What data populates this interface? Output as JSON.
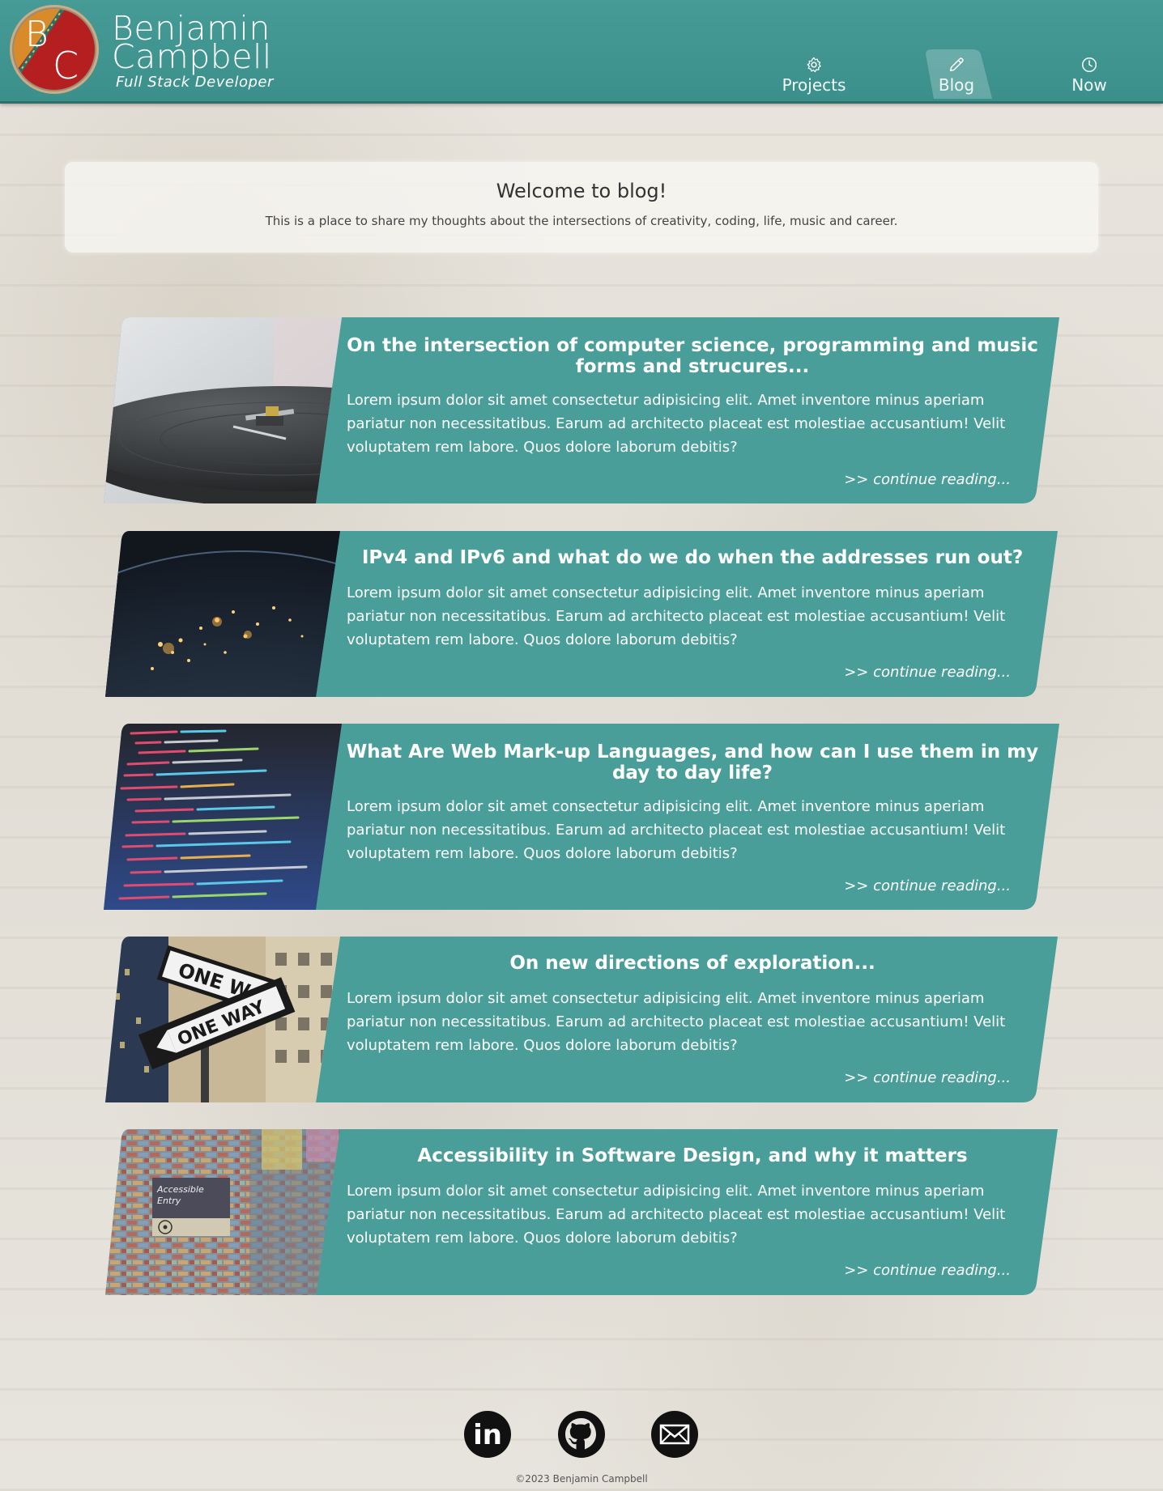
{
  "brand": {
    "monogram_left": "B",
    "monogram_right": "C",
    "name_line1": "Benjamin",
    "name_line2": "Campbell",
    "tagline": "Full Stack Developer"
  },
  "nav": {
    "items": [
      {
        "label": "Projects",
        "icon": "gear-icon"
      },
      {
        "label": "Blog",
        "icon": "pencil-icon",
        "active": true
      },
      {
        "label": "Now",
        "icon": "clock-icon"
      }
    ]
  },
  "welcome": {
    "title": "Welcome to blog!",
    "text": "This is a place to share my thoughts about the intersections of creativity, coding, life, music and career."
  },
  "posts": [
    {
      "title": "On the intersection of computer science, programming and music forms and strucures...",
      "body": "Lorem ipsum dolor sit amet consectetur adipisicing elit. Amet inventore minus aperiam pariatur non necessitatibus. Earum ad architecto placeat est molestiae accusantium! Velit voluptatem rem labore. Quos dolore laborum debitis?",
      "more": ">> continue reading...",
      "image": "record-player-image"
    },
    {
      "title": "IPv4 and IPv6 and what do we do when the addresses run out?",
      "body": "Lorem ipsum dolor sit amet consectetur adipisicing elit. Amet inventore minus aperiam pariatur non necessitatibus. Earum ad architecto placeat est molestiae accusantium! Velit voluptatem rem labore. Quos dolore laborum debitis?",
      "more": ">> continue reading...",
      "image": "earth-at-night-image"
    },
    {
      "title": "What Are Web Mark-up Languages, and how can I use them in my day to day life?",
      "body": "Lorem ipsum dolor sit amet consectetur adipisicing elit. Amet inventore minus aperiam pariatur non necessitatibus. Earum ad architecto placeat est molestiae accusantium! Velit voluptatem rem labore. Quos dolore laborum debitis?",
      "more": ">> continue reading...",
      "image": "source-code-image"
    },
    {
      "title": "On new directions of exploration...",
      "body": "Lorem ipsum dolor sit amet consectetur adipisicing elit. Amet inventore minus aperiam pariatur non necessitatibus. Earum ad architecto placeat est molestiae accusantium! Velit voluptatem rem labore. Quos dolore laborum debitis?",
      "more": ">> continue reading...",
      "image": "one-way-signs-image",
      "sign_text_1": "ONE W",
      "sign_text_2": "ONE  WAY"
    },
    {
      "title": "Accessibility in Software Design, and why it matters",
      "body": "Lorem ipsum dolor sit amet consectetur adipisicing elit. Amet inventore minus aperiam pariatur non necessitatibus. Earum ad architecto placeat est molestiae accusantium! Velit voluptatem rem labore. Quos dolore laborum debitis?",
      "more": ">> continue reading...",
      "image": "accessible-entry-sign-image",
      "sign_text_1": "Accessible",
      "sign_text_2": "Entry"
    }
  ],
  "footer": {
    "social": [
      {
        "name": "linkedin-icon",
        "glyph": "in"
      },
      {
        "name": "github-icon"
      },
      {
        "name": "email-icon"
      }
    ],
    "copyright": "©2023 Benjamin Campbell"
  },
  "colors": {
    "teal": "#4a9e99",
    "header": "#3f9490",
    "logo_orange": "#d98a2a",
    "logo_red": "#b51f1f"
  }
}
